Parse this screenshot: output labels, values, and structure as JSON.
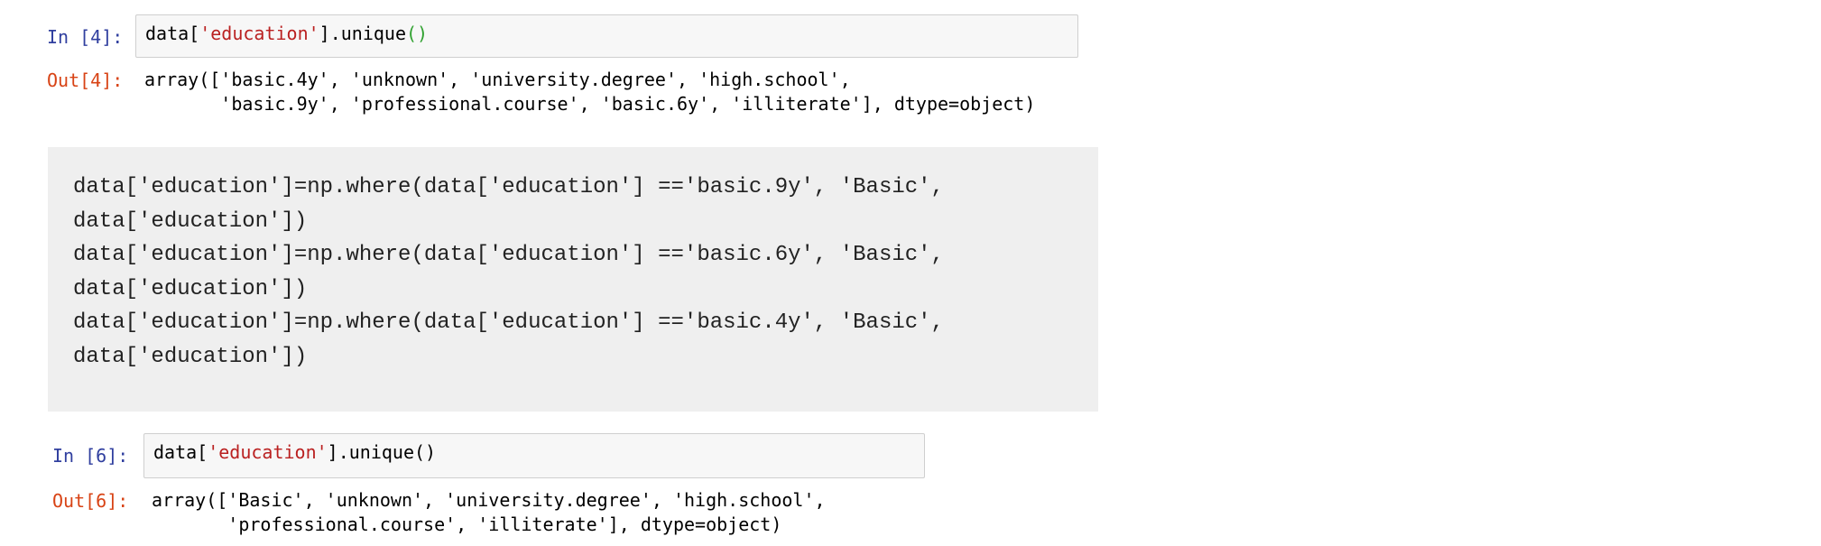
{
  "cell1": {
    "in_prompt": "In [4]:",
    "input": {
      "prefix": "data[",
      "string": "'education'",
      "suffix": "].unique",
      "parens": "()"
    },
    "out_prompt": "Out[4]:",
    "output_lines": [
      "array(['basic.4y', 'unknown', 'university.degree', 'high.school',",
      "       'basic.9y', 'professional.course', 'basic.6y', 'illiterate'], dtype=object)"
    ]
  },
  "code_block": {
    "lines": [
      "data['education']=np.where(data['education'] =='basic.9y', 'Basic',",
      "data['education'])",
      "data['education']=np.where(data['education'] =='basic.6y', 'Basic',",
      "data['education'])",
      "data['education']=np.where(data['education'] =='basic.4y', 'Basic',",
      "data['education'])"
    ]
  },
  "cell2": {
    "in_prompt": "In [6]:",
    "input": {
      "prefix": "data[",
      "string": "'education'",
      "suffix": "].unique()"
    },
    "out_prompt": "Out[6]:",
    "output_lines": [
      "array(['Basic', 'unknown', 'university.degree', 'high.school',",
      "       'professional.course', 'illiterate'], dtype=object)"
    ]
  }
}
